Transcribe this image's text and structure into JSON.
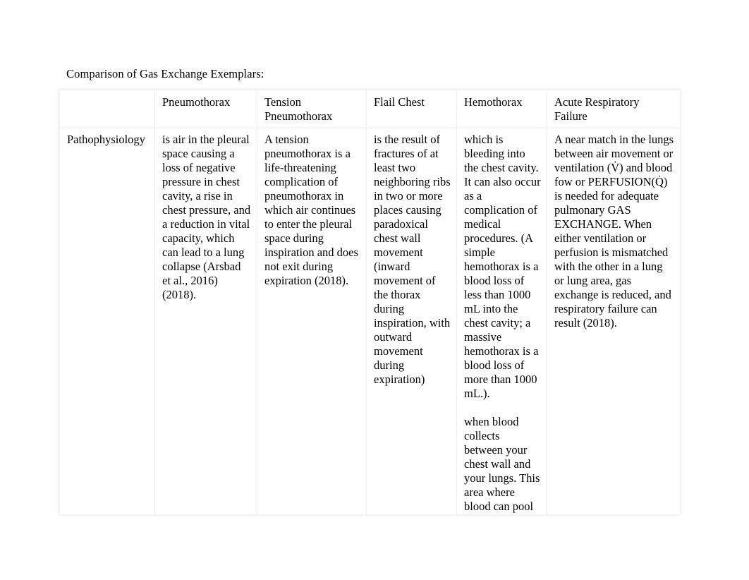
{
  "document": {
    "title": "Comparison of Gas Exchange Exemplars:"
  },
  "table": {
    "headers": [
      "",
      "Pneumothorax",
      "Tension Pneumothorax",
      "Flail Chest",
      "Hemothorax",
      "Acute Respiratory Failure"
    ],
    "rows": [
      {
        "label": "Pathophysiology",
        "cells": [
          {
            "paragraphs": [
              "is air in the pleural space causing a loss of negative pressure in chest cavity, a rise in chest pressure, and a reduction in vital capacity, which can lead to a lung collapse (Arsbad et al., 2016) (2018)."
            ]
          },
          {
            "paragraphs": [
              "A tension pneumothorax is a life-threatening complication of pneumothorax in which air continues to enter the pleural space during inspiration and does not exit during expiration (2018)."
            ]
          },
          {
            "paragraphs": [
              "is the result of fractures of at least two neighboring ribs in two or more places causing paradoxical chest wall movement (inward movement of the thorax during inspiration, with outward movement during expiration)"
            ]
          },
          {
            "paragraphs": [
              "which is bleeding into the chest cavity. It can also occur as a complication of medical procedures. (A simple hemothorax is a blood loss of less than 1000 mL into the chest cavity; a massive hemothorax is a blood loss of more than 1000 mL.).",
              "when blood collects between your chest wall and your lungs. This area where blood can pool is known as the pleural cavity. The buildup of the volume of"
            ]
          },
          {
            "paragraphs": [
              "A near match in the lungs between air movement or ventilation (V̇) and blood fow or PERFUSION(Q̇) is needed for adequate pulmonary GAS EXCHANGE. When either ventilation or perfusion is mismatched with the other in a lung or lung area, gas exchange is reduced, and respiratory failure can result (2018)."
            ]
          }
        ]
      }
    ]
  }
}
